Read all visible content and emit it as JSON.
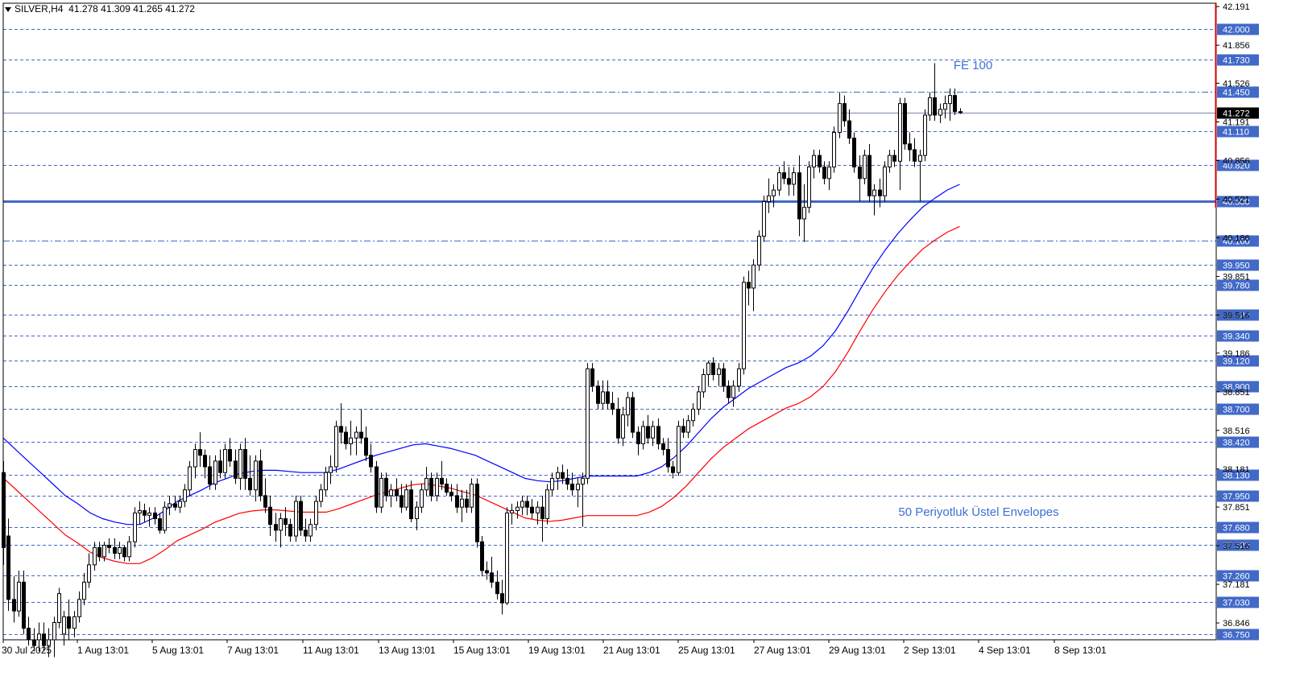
{
  "header": {
    "symbol": "SILVER,H4",
    "ohlc": "41.278 41.309 41.265 41.272"
  },
  "annotations": {
    "fe": "FE 100",
    "envelopes": "50 Periyotluk Üstel Envelopes"
  },
  "colors": {
    "bull": "#ffffff",
    "bear": "#000000",
    "ema_upper": "#0000ff",
    "ema_lower": "#ff0000",
    "level_line": "#4169c8",
    "label_bg": "#4169c8",
    "current_bg": "#000000",
    "annotation": "#3e6fd4"
  },
  "chart_data": {
    "type": "candlestick",
    "symbol": "SILVER",
    "timeframe": "H4",
    "ylim": [
      36.7,
      42.22
    ],
    "x_ticks": [
      "30 Jul 2025",
      "1 Aug 13:01",
      "5 Aug 13:01",
      "7 Aug 13:01",
      "11 Aug 13:01",
      "13 Aug 13:01",
      "15 Aug 13:01",
      "19 Aug 13:01",
      "21 Aug 13:01",
      "25 Aug 13:01",
      "27 Aug 13:01",
      "29 Aug 13:01",
      "2 Sep 13:01",
      "4 Sep 13:01",
      "8 Sep 13:01"
    ],
    "y_ticks": [
      "42.191",
      "41.856",
      "41.526",
      "41.191",
      "40.856",
      "40.521",
      "40.186",
      "39.851",
      "39.516",
      "39.186",
      "38.851",
      "38.516",
      "38.181",
      "37.851",
      "37.516",
      "37.181",
      "36.846"
    ],
    "current_price": "41.272",
    "levels": [
      {
        "price": "42.000",
        "style": "dashed"
      },
      {
        "price": "41.730",
        "style": "dashed"
      },
      {
        "price": "41.450",
        "style": "dashdot"
      },
      {
        "price": "41.110",
        "style": "dashed"
      },
      {
        "price": "40.820",
        "style": "dashed"
      },
      {
        "price": "40.500",
        "style": "solid"
      },
      {
        "price": "40.160",
        "style": "dashdot"
      },
      {
        "price": "39.950",
        "style": "dashed"
      },
      {
        "price": "39.780",
        "style": "dashed"
      },
      {
        "price": "39.520",
        "style": "dashed"
      },
      {
        "price": "39.340",
        "style": "dashed"
      },
      {
        "price": "39.120",
        "style": "dashed"
      },
      {
        "price": "38.900",
        "style": "dashed"
      },
      {
        "price": "38.700",
        "style": "dashed"
      },
      {
        "price": "38.420",
        "style": "dashed"
      },
      {
        "price": "38.130",
        "style": "dashed"
      },
      {
        "price": "37.950",
        "style": "dashed"
      },
      {
        "price": "37.680",
        "style": "dashed"
      },
      {
        "price": "37.520",
        "style": "dashed"
      },
      {
        "price": "37.260",
        "style": "dashed"
      },
      {
        "price": "37.030",
        "style": "dashed"
      },
      {
        "price": "36.750",
        "style": "dashed"
      }
    ],
    "candles": [
      [
        38.15,
        38.25,
        37.35,
        37.5
      ],
      [
        37.6,
        37.75,
        36.95,
        37.05
      ],
      [
        37.05,
        37.25,
        36.85,
        36.95
      ],
      [
        36.95,
        37.3,
        36.9,
        37.2
      ],
      [
        37.2,
        37.3,
        36.75,
        36.8
      ],
      [
        36.8,
        36.9,
        36.65,
        36.7
      ],
      [
        36.7,
        36.8,
        36.6,
        36.65
      ],
      [
        36.7,
        36.85,
        36.6,
        36.75
      ],
      [
        36.75,
        36.85,
        36.6,
        36.65
      ],
      [
        36.65,
        36.8,
        36.55,
        36.7
      ],
      [
        36.7,
        36.9,
        36.55,
        36.85
      ],
      [
        36.85,
        37.15,
        36.8,
        37.1
      ],
      [
        36.75,
        36.95,
        36.65,
        36.9
      ],
      [
        36.9,
        37.05,
        36.7,
        36.8
      ],
      [
        36.8,
        36.95,
        36.72,
        36.9
      ],
      [
        36.9,
        37.12,
        36.85,
        37.05
      ],
      [
        37.05,
        37.28,
        37.0,
        37.2
      ],
      [
        37.2,
        37.45,
        37.15,
        37.35
      ],
      [
        37.35,
        37.55,
        37.3,
        37.5
      ],
      [
        37.5,
        37.55,
        37.38,
        37.42
      ],
      [
        37.42,
        37.55,
        37.38,
        37.52
      ],
      [
        37.52,
        37.58,
        37.45,
        37.5
      ],
      [
        37.5,
        37.58,
        37.4,
        37.45
      ],
      [
        37.45,
        37.55,
        37.4,
        37.5
      ],
      [
        37.5,
        37.52,
        37.38,
        37.42
      ],
      [
        37.42,
        37.6,
        37.38,
        37.55
      ],
      [
        37.55,
        37.85,
        37.5,
        37.8
      ],
      [
        37.8,
        37.9,
        37.7,
        37.82
      ],
      [
        37.82,
        37.88,
        37.72,
        37.78
      ],
      [
        37.78,
        37.85,
        37.68,
        37.8
      ],
      [
        37.8,
        37.85,
        37.7,
        37.75
      ],
      [
        37.75,
        37.8,
        37.62,
        37.65
      ],
      [
        37.65,
        37.9,
        37.62,
        37.85
      ],
      [
        37.85,
        37.95,
        37.78,
        37.88
      ],
      [
        37.88,
        37.95,
        37.82,
        37.85
      ],
      [
        37.85,
        37.95,
        37.8,
        37.9
      ],
      [
        37.9,
        38.05,
        37.85,
        38.0
      ],
      [
        38.0,
        38.25,
        37.95,
        38.2
      ],
      [
        38.2,
        38.4,
        38.1,
        38.35
      ],
      [
        38.35,
        38.5,
        38.2,
        38.3
      ],
      [
        38.3,
        38.35,
        38.1,
        38.2
      ],
      [
        38.2,
        38.3,
        38.0,
        38.05
      ],
      [
        38.05,
        38.3,
        38.0,
        38.25
      ],
      [
        38.25,
        38.35,
        38.1,
        38.15
      ],
      [
        38.15,
        38.4,
        38.1,
        38.35
      ],
      [
        38.35,
        38.45,
        38.2,
        38.25
      ],
      [
        38.25,
        38.35,
        38.05,
        38.1
      ],
      [
        38.1,
        38.4,
        38.0,
        38.35
      ],
      [
        38.35,
        38.45,
        38.0,
        38.1
      ],
      [
        38.1,
        38.3,
        37.95,
        38.0
      ],
      [
        38.0,
        38.3,
        37.9,
        38.25
      ],
      [
        38.25,
        38.35,
        37.9,
        37.95
      ],
      [
        37.95,
        38.1,
        37.8,
        37.85
      ],
      [
        37.85,
        37.95,
        37.6,
        37.7
      ],
      [
        37.7,
        37.8,
        37.55,
        37.65
      ],
      [
        37.65,
        37.8,
        37.5,
        37.75
      ],
      [
        37.75,
        37.85,
        37.6,
        37.7
      ],
      [
        37.7,
        37.75,
        37.55,
        37.6
      ],
      [
        37.6,
        37.95,
        37.55,
        37.9
      ],
      [
        37.9,
        37.95,
        37.6,
        37.65
      ],
      [
        37.65,
        37.75,
        37.55,
        37.6
      ],
      [
        37.6,
        37.75,
        37.55,
        37.7
      ],
      [
        37.7,
        37.95,
        37.65,
        37.9
      ],
      [
        37.9,
        38.05,
        37.85,
        38.0
      ],
      [
        38.0,
        38.2,
        37.95,
        38.15
      ],
      [
        38.15,
        38.3,
        38.05,
        38.2
      ],
      [
        38.2,
        38.6,
        38.15,
        38.55
      ],
      [
        38.55,
        38.75,
        38.4,
        38.5
      ],
      [
        38.5,
        38.55,
        38.35,
        38.4
      ],
      [
        38.4,
        38.6,
        38.3,
        38.45
      ],
      [
        38.45,
        38.55,
        38.3,
        38.5
      ],
      [
        38.5,
        38.7,
        38.4,
        38.45
      ],
      [
        38.45,
        38.55,
        38.25,
        38.3
      ],
      [
        38.3,
        38.4,
        38.15,
        38.2
      ],
      [
        38.2,
        38.25,
        37.8,
        37.85
      ],
      [
        37.85,
        38.15,
        37.8,
        38.1
      ],
      [
        38.1,
        38.15,
        37.9,
        37.95
      ],
      [
        37.95,
        38.05,
        37.85,
        38.0
      ],
      [
        38.0,
        38.1,
        37.9,
        37.95
      ],
      [
        37.95,
        38.05,
        37.8,
        37.85
      ],
      [
        37.85,
        38.05,
        37.82,
        38.0
      ],
      [
        38.0,
        38.08,
        37.72,
        37.75
      ],
      [
        37.75,
        37.9,
        37.65,
        37.85
      ],
      [
        37.85,
        38.05,
        37.8,
        38.0
      ],
      [
        38.0,
        38.2,
        37.95,
        38.1
      ],
      [
        38.1,
        38.15,
        37.9,
        37.95
      ],
      [
        37.95,
        38.15,
        37.9,
        38.1
      ],
      [
        38.1,
        38.25,
        38.0,
        38.05
      ],
      [
        38.05,
        38.1,
        37.95,
        37.98
      ],
      [
        37.98,
        38.05,
        37.9,
        37.95
      ],
      [
        37.95,
        38.05,
        37.8,
        37.85
      ],
      [
        37.85,
        38.0,
        37.72,
        37.92
      ],
      [
        37.92,
        38.0,
        37.8,
        37.85
      ],
      [
        37.85,
        38.1,
        37.8,
        38.05
      ],
      [
        38.05,
        38.1,
        37.5,
        37.55
      ],
      [
        37.55,
        37.6,
        37.25,
        37.3
      ],
      [
        37.3,
        37.38,
        37.22,
        37.28
      ],
      [
        37.28,
        37.42,
        37.15,
        37.2
      ],
      [
        37.2,
        37.3,
        37.05,
        37.1
      ],
      [
        37.1,
        37.22,
        36.92,
        37.02
      ],
      [
        37.02,
        37.85,
        37.0,
        37.8
      ],
      [
        37.8,
        37.88,
        37.7,
        37.82
      ],
      [
        37.82,
        37.9,
        37.75,
        37.85
      ],
      [
        37.85,
        37.95,
        37.78,
        37.9
      ],
      [
        37.9,
        37.95,
        37.78,
        37.85
      ],
      [
        37.85,
        37.92,
        37.75,
        37.8
      ],
      [
        37.8,
        37.9,
        37.7,
        37.85
      ],
      [
        37.85,
        37.95,
        37.55,
        37.75
      ],
      [
        37.75,
        38.05,
        37.7,
        38.0
      ],
      [
        38.0,
        38.15,
        37.95,
        38.1
      ],
      [
        38.1,
        38.2,
        38.0,
        38.15
      ],
      [
        38.15,
        38.22,
        38.05,
        38.1
      ],
      [
        38.1,
        38.18,
        38.0,
        38.05
      ],
      [
        38.05,
        38.15,
        37.95,
        38.0
      ],
      [
        38.0,
        38.1,
        37.85,
        38.05
      ],
      [
        38.05,
        38.15,
        37.68,
        38.1
      ],
      [
        38.1,
        39.1,
        38.05,
        39.05
      ],
      [
        39.05,
        39.1,
        38.85,
        38.9
      ],
      [
        38.9,
        38.95,
        38.7,
        38.75
      ],
      [
        38.75,
        38.95,
        38.7,
        38.85
      ],
      [
        38.85,
        38.95,
        38.7,
        38.75
      ],
      [
        38.75,
        38.85,
        38.65,
        38.7
      ],
      [
        38.7,
        38.8,
        38.4,
        38.45
      ],
      [
        38.45,
        38.72,
        38.38,
        38.65
      ],
      [
        38.65,
        38.85,
        38.55,
        38.8
      ],
      [
        38.8,
        38.85,
        38.45,
        38.5
      ],
      [
        38.5,
        38.55,
        38.3,
        38.4
      ],
      [
        38.4,
        38.6,
        38.35,
        38.55
      ],
      [
        38.55,
        38.65,
        38.4,
        38.45
      ],
      [
        38.45,
        38.6,
        38.38,
        38.55
      ],
      [
        38.55,
        38.62,
        38.35,
        38.4
      ],
      [
        38.4,
        38.45,
        38.3,
        38.35
      ],
      [
        38.35,
        38.45,
        38.15,
        38.2
      ],
      [
        38.2,
        38.25,
        38.1,
        38.15
      ],
      [
        38.15,
        38.6,
        38.12,
        38.55
      ],
      [
        38.55,
        38.62,
        38.45,
        38.5
      ],
      [
        38.5,
        38.65,
        38.45,
        38.6
      ],
      [
        38.6,
        38.75,
        38.55,
        38.7
      ],
      [
        38.7,
        38.9,
        38.65,
        38.85
      ],
      [
        38.85,
        39.05,
        38.8,
        39.0
      ],
      [
        39.0,
        39.12,
        38.9,
        39.1
      ],
      [
        39.1,
        39.15,
        38.95,
        39.0
      ],
      [
        39.0,
        39.1,
        38.9,
        39.05
      ],
      [
        39.05,
        39.1,
        38.85,
        38.9
      ],
      [
        38.9,
        38.95,
        38.75,
        38.8
      ],
      [
        38.8,
        38.95,
        38.72,
        38.9
      ],
      [
        38.9,
        39.1,
        38.85,
        39.05
      ],
      [
        39.05,
        39.85,
        39.0,
        39.8
      ],
      [
        39.8,
        39.9,
        39.6,
        39.75
      ],
      [
        39.75,
        40.0,
        39.55,
        39.95
      ],
      [
        39.95,
        40.25,
        39.9,
        40.2
      ],
      [
        40.2,
        40.55,
        40.15,
        40.5
      ],
      [
        40.5,
        40.7,
        40.4,
        40.55
      ],
      [
        40.55,
        40.65,
        40.45,
        40.6
      ],
      [
        40.6,
        40.8,
        40.55,
        40.75
      ],
      [
        40.75,
        40.85,
        40.65,
        40.7
      ],
      [
        40.7,
        40.8,
        40.55,
        40.65
      ],
      [
        40.65,
        40.8,
        40.55,
        40.75
      ],
      [
        40.75,
        40.9,
        40.2,
        40.35
      ],
      [
        40.35,
        40.65,
        40.15,
        40.45
      ],
      [
        40.45,
        40.85,
        40.4,
        40.8
      ],
      [
        40.8,
        40.95,
        40.7,
        40.9
      ],
      [
        40.9,
        40.95,
        40.75,
        40.8
      ],
      [
        40.8,
        40.85,
        40.65,
        40.7
      ],
      [
        40.7,
        40.85,
        40.6,
        40.8
      ],
      [
        40.8,
        41.15,
        40.75,
        41.1
      ],
      [
        41.1,
        41.45,
        41.05,
        41.35
      ],
      [
        41.35,
        41.42,
        41.15,
        41.2
      ],
      [
        41.2,
        41.3,
        41.0,
        41.05
      ],
      [
        41.05,
        41.1,
        40.75,
        40.8
      ],
      [
        40.8,
        40.9,
        40.5,
        40.7
      ],
      [
        40.7,
        40.95,
        40.65,
        40.9
      ],
      [
        40.9,
        41.0,
        40.5,
        40.55
      ],
      [
        40.55,
        40.65,
        40.38,
        40.6
      ],
      [
        40.6,
        40.7,
        40.45,
        40.55
      ],
      [
        40.55,
        40.85,
        40.5,
        40.8
      ],
      [
        40.8,
        40.95,
        40.75,
        40.9
      ],
      [
        40.9,
        40.95,
        40.8,
        40.85
      ],
      [
        40.85,
        41.4,
        40.6,
        41.35
      ],
      [
        41.35,
        41.4,
        40.95,
        41.0
      ],
      [
        41.0,
        41.1,
        40.85,
        40.95
      ],
      [
        40.95,
        41.05,
        40.8,
        40.85
      ],
      [
        40.85,
        40.95,
        40.5,
        40.9
      ],
      [
        40.9,
        41.3,
        40.85,
        41.25
      ],
      [
        41.25,
        41.45,
        41.2,
        41.4
      ],
      [
        41.4,
        41.7,
        41.2,
        41.25
      ],
      [
        41.25,
        41.35,
        41.18,
        41.3
      ],
      [
        41.3,
        41.42,
        41.22,
        41.35
      ],
      [
        41.35,
        41.48,
        41.2,
        41.42
      ],
      [
        41.42,
        41.48,
        41.25,
        41.28
      ],
      [
        41.28,
        41.31,
        41.26,
        41.27
      ]
    ],
    "ema_upper": [
      38.45,
      38.35,
      38.25,
      38.15,
      38.05,
      37.95,
      37.88,
      37.8,
      37.75,
      37.72,
      37.7,
      37.7,
      37.75,
      37.82,
      37.9,
      37.95,
      38.0,
      38.06,
      38.1,
      38.14,
      38.16,
      38.17,
      38.17,
      38.16,
      38.15,
      38.15,
      38.15,
      38.18,
      38.22,
      38.26,
      38.3,
      38.33,
      38.36,
      38.39,
      38.4,
      38.38,
      38.36,
      38.33,
      38.3,
      38.25,
      38.2,
      38.15,
      38.1,
      38.08,
      38.07,
      38.08,
      38.1,
      38.12,
      38.12,
      38.12,
      38.12,
      38.12,
      38.15,
      38.2,
      38.28,
      38.38,
      38.5,
      38.62,
      38.72,
      38.8,
      38.88,
      38.94,
      39.0,
      39.06,
      39.1,
      39.16,
      39.25,
      39.38,
      39.55,
      39.74,
      39.92,
      40.08,
      40.22,
      40.34,
      40.45,
      40.53,
      40.6,
      40.65
    ]
  }
}
